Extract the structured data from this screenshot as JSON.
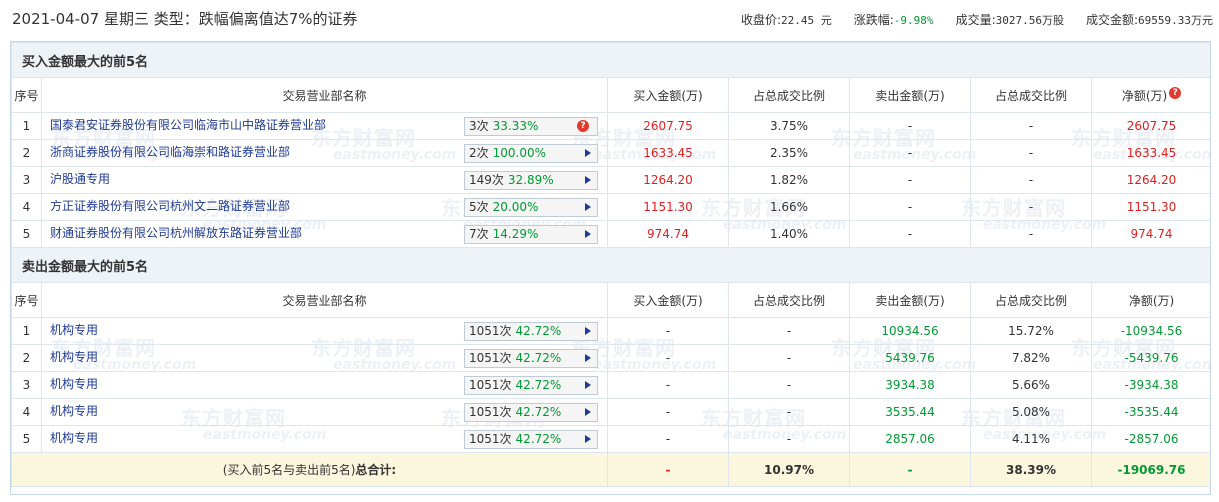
{
  "header": {
    "title": "2021-04-07 星期三  类型：跌幅偏离值达7%的证券",
    "close_label": "收盘价:",
    "close_value": "22.45 元",
    "change_label": "涨跌幅:",
    "change_value": "-9.98%",
    "volume_label": "成交量:",
    "volume_value": "3027.56万股",
    "turnover_label": "成交金额:",
    "turnover_value": "69559.33万元"
  },
  "buy_section": {
    "title": "买入金额最大的前5名",
    "columns": [
      "序号",
      "交易营业部名称",
      "买入金额(万)",
      "占总成交比例",
      "卖出金额(万)",
      "占总成交比例",
      "净额(万)"
    ],
    "rows": [
      {
        "idx": "1",
        "name": "国泰君安证券股份有限公司临海市山中路证券营业部",
        "times": "3次",
        "pct": "33.33%",
        "buy": "2607.75",
        "buy_ratio": "3.75%",
        "sell": "-",
        "sell_ratio": "-",
        "net": "2607.75"
      },
      {
        "idx": "2",
        "name": "浙商证券股份有限公司临海崇和路证券营业部",
        "times": "2次",
        "pct": "100.00%",
        "buy": "1633.45",
        "buy_ratio": "2.35%",
        "sell": "-",
        "sell_ratio": "-",
        "net": "1633.45"
      },
      {
        "idx": "3",
        "name": "沪股通专用",
        "times": "149次",
        "pct": "32.89%",
        "buy": "1264.20",
        "buy_ratio": "1.82%",
        "sell": "-",
        "sell_ratio": "-",
        "net": "1264.20"
      },
      {
        "idx": "4",
        "name": "方正证券股份有限公司杭州文二路证券营业部",
        "times": "5次",
        "pct": "20.00%",
        "buy": "1151.30",
        "buy_ratio": "1.66%",
        "sell": "-",
        "sell_ratio": "-",
        "net": "1151.30"
      },
      {
        "idx": "5",
        "name": "财通证券股份有限公司杭州解放东路证券营业部",
        "times": "7次",
        "pct": "14.29%",
        "buy": "974.74",
        "buy_ratio": "1.40%",
        "sell": "-",
        "sell_ratio": "-",
        "net": "974.74"
      }
    ]
  },
  "sell_section": {
    "title": "卖出金额最大的前5名",
    "columns": [
      "序号",
      "交易营业部名称",
      "买入金额(万)",
      "占总成交比例",
      "卖出金额(万)",
      "占总成交比例",
      "净额(万)"
    ],
    "rows": [
      {
        "idx": "1",
        "name": "机构专用",
        "times": "1051次",
        "pct": "42.72%",
        "buy": "-",
        "buy_ratio": "-",
        "sell": "10934.56",
        "sell_ratio": "15.72%",
        "net": "-10934.56"
      },
      {
        "idx": "2",
        "name": "机构专用",
        "times": "1051次",
        "pct": "42.72%",
        "buy": "-",
        "buy_ratio": "-",
        "sell": "5439.76",
        "sell_ratio": "7.82%",
        "net": "-5439.76"
      },
      {
        "idx": "3",
        "name": "机构专用",
        "times": "1051次",
        "pct": "42.72%",
        "buy": "-",
        "buy_ratio": "-",
        "sell": "3934.38",
        "sell_ratio": "5.66%",
        "net": "-3934.38"
      },
      {
        "idx": "4",
        "name": "机构专用",
        "times": "1051次",
        "pct": "42.72%",
        "buy": "-",
        "buy_ratio": "-",
        "sell": "3535.44",
        "sell_ratio": "5.08%",
        "net": "-3535.44"
      },
      {
        "idx": "5",
        "name": "机构专用",
        "times": "1051次",
        "pct": "42.72%",
        "buy": "-",
        "buy_ratio": "-",
        "sell": "2857.06",
        "sell_ratio": "4.11%",
        "net": "-2857.06"
      }
    ]
  },
  "total": {
    "label": "(买入前5名与卖出前5名)",
    "label_bold": "总合计:",
    "buy": "-",
    "buy_ratio": "10.97%",
    "sell": "-",
    "sell_ratio": "38.39%",
    "net": "-19069.76"
  },
  "watermark": {
    "cn": "东方财富网",
    "en": "eastmoney.com"
  },
  "icons": {
    "question": "?"
  },
  "colors": {
    "up": "#e02020",
    "down": "#009933",
    "link": "#1f3a93",
    "section_bg": "#eef3f8",
    "total_bg": "#fbf7df"
  }
}
